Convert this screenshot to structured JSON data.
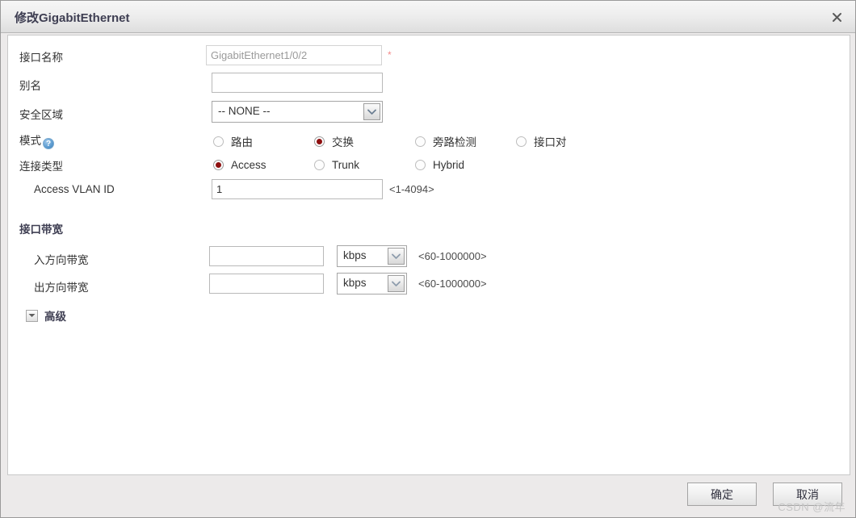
{
  "dialog": {
    "title": "修改GigabitEthernet",
    "close_icon": "close-icon"
  },
  "fields": {
    "interface_name": {
      "label": "接口名称",
      "value": "GigabitEthernet1/0/2",
      "required_marker": "*"
    },
    "alias": {
      "label": "别名",
      "value": ""
    },
    "security_zone": {
      "label": "安全区域",
      "value": "-- NONE --"
    },
    "mode": {
      "label": "模式",
      "help_icon": "?",
      "options": [
        {
          "label": "路由",
          "checked": false
        },
        {
          "label": "交换",
          "checked": true
        },
        {
          "label": "旁路检测",
          "checked": false
        },
        {
          "label": "接口对",
          "checked": false
        }
      ]
    },
    "link_type": {
      "label": "连接类型",
      "options": [
        {
          "label": "Access",
          "checked": true
        },
        {
          "label": "Trunk",
          "checked": false
        },
        {
          "label": "Hybrid",
          "checked": false
        }
      ]
    },
    "access_vlan_id": {
      "label": "Access VLAN ID",
      "value": "1",
      "hint": "<1-4094>"
    }
  },
  "bandwidth": {
    "section_title": "接口带宽",
    "inbound": {
      "label": "入方向带宽",
      "value": "",
      "unit": "kbps",
      "hint": "<60-1000000>"
    },
    "outbound": {
      "label": "出方向带宽",
      "value": "",
      "unit": "kbps",
      "hint": "<60-1000000>"
    }
  },
  "advanced": {
    "label": "高级",
    "expanded": false
  },
  "footer": {
    "ok_label": "确定",
    "cancel_label": "取消"
  },
  "watermark": "CSDN @流年"
}
